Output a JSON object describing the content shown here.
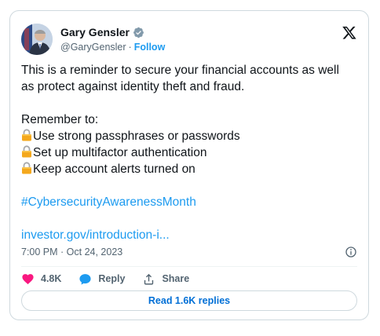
{
  "author": {
    "display_name": "Gary Gensler",
    "handle": "@GaryGensler",
    "separator": "·",
    "follow_label": "Follow"
  },
  "tweet": {
    "intro_lines": [
      "This is a reminder to secure your financial accounts as well",
      "as protect against identity theft and fraud."
    ],
    "remember_label": "Remember to:",
    "items": [
      "Use strong passphrases or passwords",
      "Set up multifactor authentication",
      "Keep account alerts turned on"
    ],
    "hashtag": "#CybersecurityAwarenessMonth",
    "link": "investor.gov/introduction-i..."
  },
  "meta": {
    "timestamp": "7:00 PM · Oct 24, 2023"
  },
  "actions": {
    "likes": "4.8K",
    "reply_label": "Reply",
    "share_label": "Share"
  },
  "replies_button_label": "Read 1.6K replies",
  "icons": {
    "verified": "verified-badge-icon",
    "x_logo": "x-logo-icon",
    "lock": "lock-emoji-icon",
    "info": "info-icon",
    "heart": "heart-icon",
    "reply": "reply-bubble-icon",
    "share": "share-icon"
  },
  "colors": {
    "link": "#1d9bf0",
    "heart": "#f91880",
    "muted": "#536471",
    "replies_button_text": "#006fd6"
  }
}
